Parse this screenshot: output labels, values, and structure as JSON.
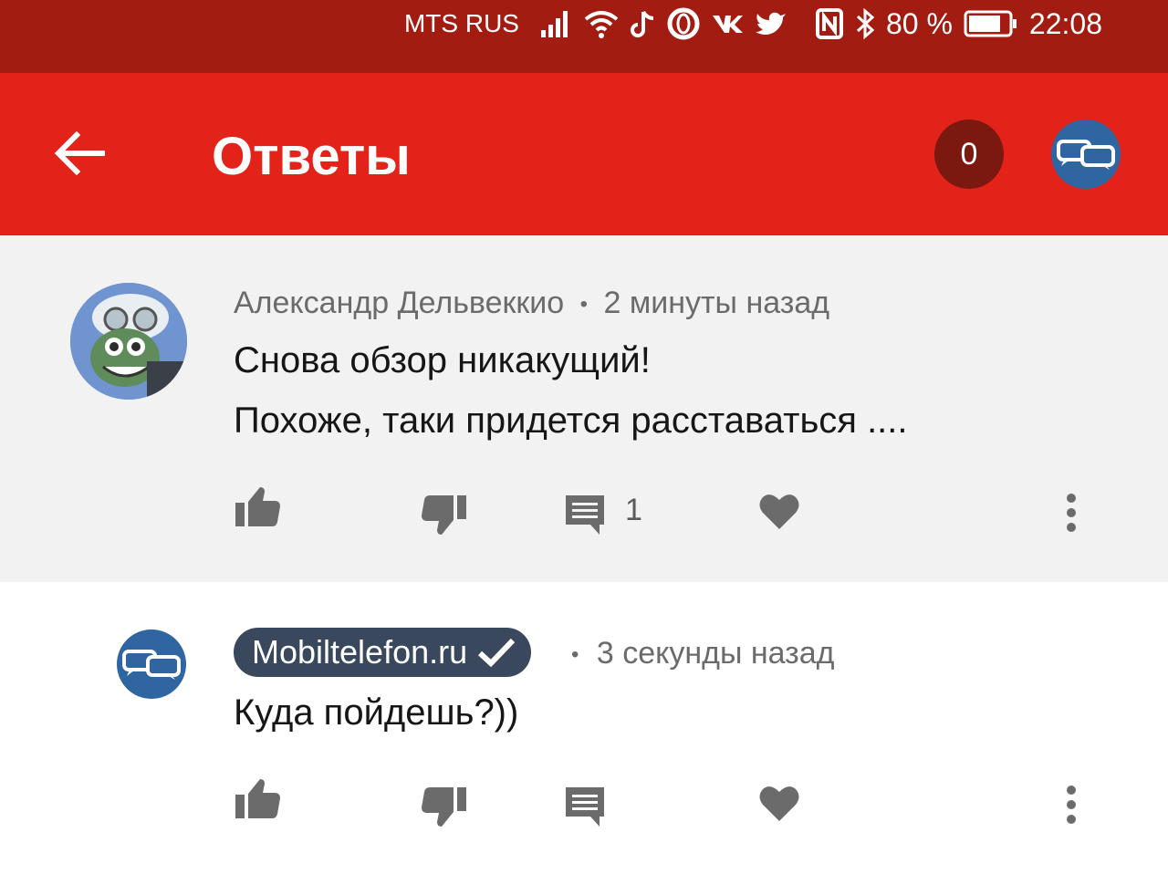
{
  "status_bar": {
    "carrier": "MTS RUS",
    "battery": "80 %",
    "time": "22:08",
    "icons": [
      "signal-icon",
      "wifi-icon",
      "tiktok-icon",
      "opera-icon",
      "vk-icon",
      "twitter-icon",
      "nfc-icon",
      "bluetooth-icon",
      "battery-icon"
    ]
  },
  "app_bar": {
    "title": "Ответы",
    "notification_count": "0",
    "colors": {
      "app_bar": "#e32219",
      "status_bar": "#a31c12",
      "badge": "#7b1810",
      "avatar": "#2f65a0"
    }
  },
  "comments": [
    {
      "author": "Александр Дельвеккио",
      "separator": "•",
      "time": "2 минуты назад",
      "lines": [
        "Снова обзор никакущий!",
        "Похоже, таки придется расставаться ...."
      ],
      "reply_count": "1",
      "icons": [
        "like-icon",
        "dislike-icon",
        "reply-icon",
        "heart-icon",
        "more-icon"
      ]
    },
    {
      "author": "Mobiltelefon.ru",
      "separator": "•",
      "time": "3 секунды назад",
      "lines": [
        "Куда пойдешь?))"
      ],
      "verified_icon": "checkmark-icon",
      "icons": [
        "like-icon",
        "dislike-icon",
        "reply-icon",
        "heart-icon",
        "more-icon"
      ]
    }
  ]
}
